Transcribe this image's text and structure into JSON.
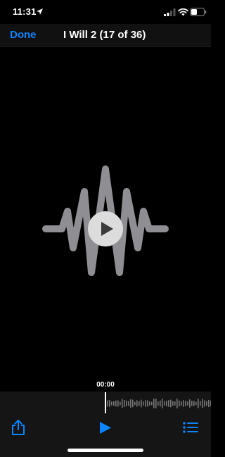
{
  "status_bar": {
    "time": "11:31",
    "icons": [
      "location-arrow-icon",
      "cellular-signal-icon",
      "wifi-icon",
      "battery-icon"
    ]
  },
  "nav": {
    "done_label": "Done",
    "title": "I Will 2 (17 of 36)"
  },
  "player": {
    "current_time": "00:00",
    "artwork_icon": "waveform-icon",
    "center_icon": "play-icon"
  },
  "toolbar": {
    "left_icon": "share-icon",
    "center_icon": "play-icon",
    "right_icon": "list-icon"
  },
  "colors": {
    "accent": "#0a84ff",
    "background": "#000000",
    "waveform": "#8e8e93"
  }
}
